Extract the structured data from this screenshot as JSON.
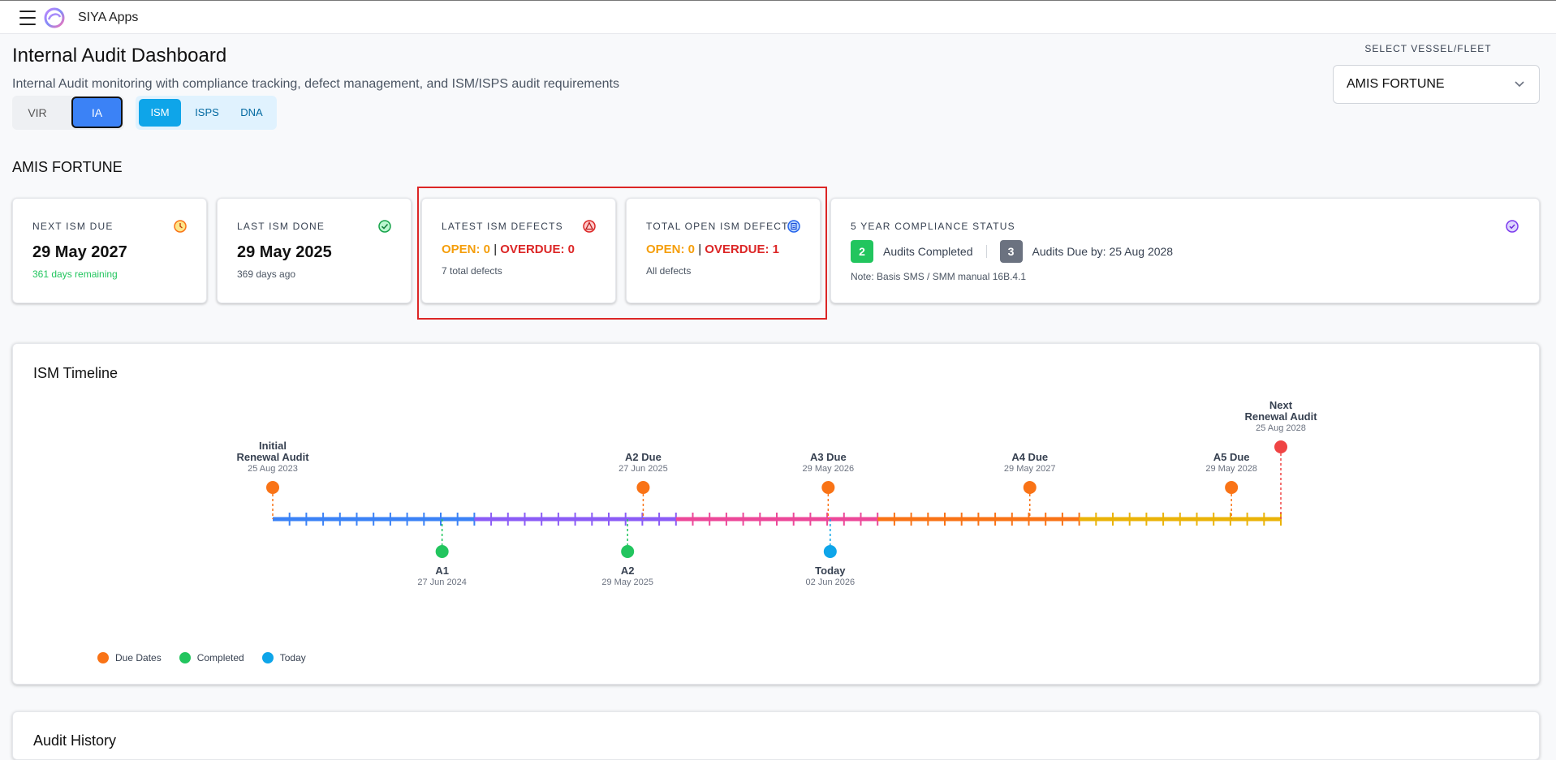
{
  "app": {
    "name": "SIYA Apps"
  },
  "header": {
    "title": "Internal Audit Dashboard",
    "subtitle": "Internal Audit monitoring with compliance tracking, defect management, and ISM/ISPS audit requirements"
  },
  "toggles": {
    "type": [
      {
        "label": "VIR",
        "active": false
      },
      {
        "label": "IA",
        "active": true
      }
    ],
    "audit": [
      {
        "label": "ISM",
        "active": true
      },
      {
        "label": "ISPS",
        "active": false
      },
      {
        "label": "DNA",
        "active": false
      }
    ]
  },
  "vessel_select": {
    "label": "SELECT VESSEL/FLEET",
    "value": "AMIS FORTUNE"
  },
  "vessel_heading": "AMIS FORTUNE",
  "cards": {
    "next_due": {
      "label": "NEXT ISM DUE",
      "date": "29 May 2027",
      "sub": "361 days remaining"
    },
    "last_done": {
      "label": "LAST ISM DONE",
      "date": "29 May 2025",
      "sub": "369 days ago"
    },
    "latest_defects": {
      "label": "LATEST ISM DEFECTS",
      "open": "OPEN: 0",
      "sep": "|",
      "overdue": "OVERDUE: 0",
      "sub": "7 total defects"
    },
    "total_open": {
      "label": "TOTAL OPEN ISM DEFECTS",
      "open": "OPEN: 0",
      "sep": "|",
      "overdue": "OVERDUE: 1",
      "sub": "All defects"
    },
    "compliance": {
      "label": "5 YEAR COMPLIANCE STATUS",
      "completed_count": "2",
      "completed_label": "Audits Completed",
      "due_count": "3",
      "due_label": "Audits Due by: 25 Aug 2028",
      "note": "Note: Basis SMS / SMM manual 16B.4.1"
    }
  },
  "timeline": {
    "title": "ISM Timeline",
    "colors": {
      "due": "#f97316",
      "completed": "#22c55e",
      "today": "#0ea5e9",
      "renewal": "#ef4444",
      "segments": [
        "#3b82f6",
        "#8b5cf6",
        "#ec4899",
        "#f97316",
        "#eab308"
      ]
    },
    "markers": [
      {
        "kind": "due",
        "title": [
          "Initial",
          "Renewal Audit"
        ],
        "date": "25 Aug 2023",
        "pos": 0.0,
        "side": "top"
      },
      {
        "kind": "completed",
        "title": [
          "A1"
        ],
        "date": "27 Jun 2024",
        "pos": 0.168,
        "side": "bottom"
      },
      {
        "kind": "due",
        "title": [
          "A2 Due"
        ],
        "date": "27 Jun 2025",
        "pos": 0.3675,
        "side": "top"
      },
      {
        "kind": "completed",
        "title": [
          "A2"
        ],
        "date": "29 May 2025",
        "pos": 0.352,
        "side": "bottom"
      },
      {
        "kind": "due",
        "title": [
          "A3 Due"
        ],
        "date": "29 May 2026",
        "pos": 0.551,
        "side": "top"
      },
      {
        "kind": "today",
        "title": [
          "Today"
        ],
        "date": "02 Jun 2026",
        "pos": 0.553,
        "side": "bottom"
      },
      {
        "kind": "due",
        "title": [
          "A4 Due"
        ],
        "date": "29 May 2027",
        "pos": 0.751,
        "side": "top"
      },
      {
        "kind": "due",
        "title": [
          "A5 Due"
        ],
        "date": "29 May 2028",
        "pos": 0.951,
        "side": "top"
      },
      {
        "kind": "renewal",
        "title": [
          "Next",
          "Renewal Audit"
        ],
        "date": "25 Aug 2028",
        "pos": 1.0,
        "side": "top-high"
      }
    ],
    "legend": [
      {
        "label": "Due Dates",
        "kind": "due"
      },
      {
        "label": "Completed",
        "kind": "completed"
      },
      {
        "label": "Today",
        "kind": "today"
      }
    ]
  },
  "audit_history": {
    "title": "Audit History"
  }
}
